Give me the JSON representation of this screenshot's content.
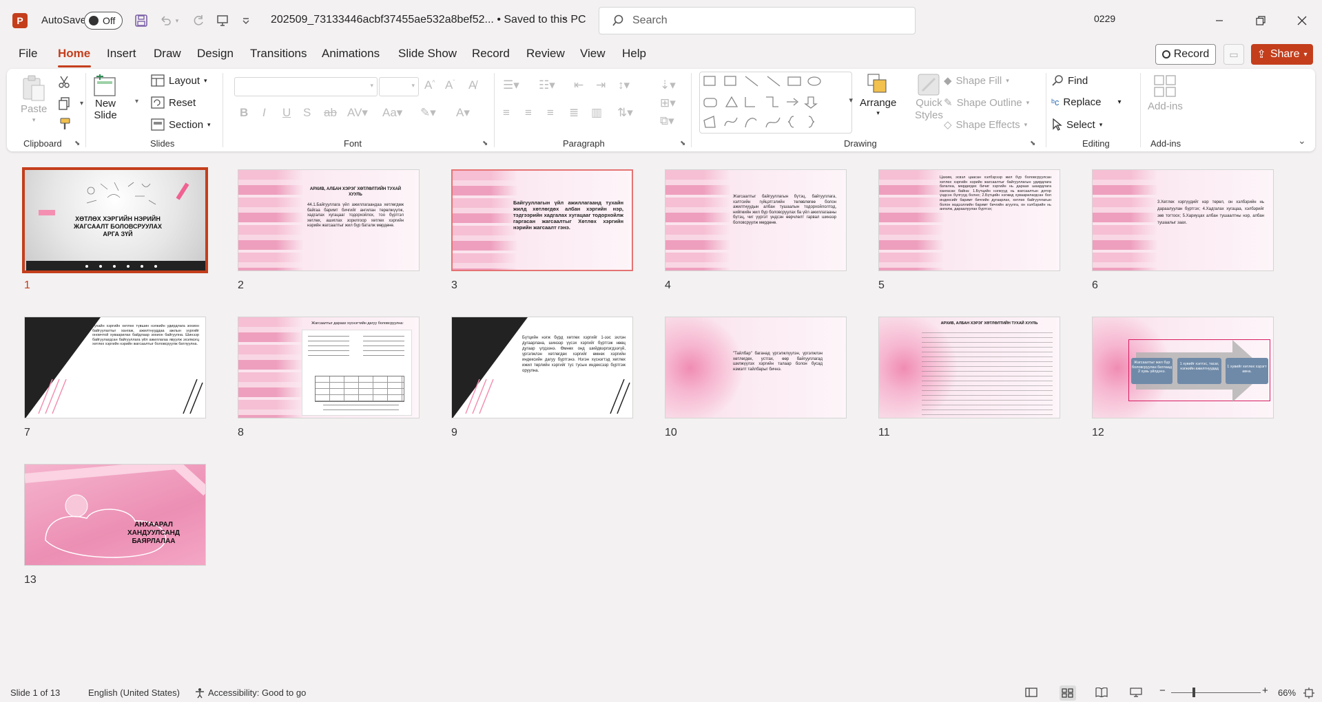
{
  "titlebar": {
    "autosave_label": "AutoSave",
    "autosave_state": "Off",
    "doc_title": "202509_73133446acbf37455ae532a8bef52... • Saved to this PC",
    "search_placeholder": "Search",
    "user": "0229"
  },
  "tabs": [
    "File",
    "Home",
    "Insert",
    "Draw",
    "Design",
    "Transitions",
    "Animations",
    "Slide Show",
    "Record",
    "Review",
    "View",
    "Help"
  ],
  "active_tab": "Home",
  "actions": {
    "record": "Record",
    "share": "Share"
  },
  "ribbon": {
    "clipboard": {
      "label": "Clipboard",
      "paste": "Paste"
    },
    "slides": {
      "label": "Slides",
      "new_slide_1": "New",
      "new_slide_2": "Slide",
      "layout": "Layout",
      "reset": "Reset",
      "section": "Section"
    },
    "font": {
      "label": "Font"
    },
    "paragraph": {
      "label": "Paragraph"
    },
    "drawing": {
      "label": "Drawing",
      "arrange": "Arrange",
      "quick_styles_1": "Quick",
      "quick_styles_2": "Styles",
      "shape_fill": "Shape Fill",
      "shape_outline": "Shape Outline",
      "shape_effects": "Shape Effects"
    },
    "editing": {
      "label": "Editing",
      "find": "Find",
      "replace": "Replace",
      "select": "Select"
    },
    "addins": {
      "label": "Add-ins",
      "button": "Add-ins"
    }
  },
  "slides": {
    "s1_title": "ХӨТЛӨХ ХЭРГИЙН НЭРИЙН ЖАГСААЛТ БОЛОВСРУУЛАХ АРГА ЗҮЙ",
    "s2_title": "АРХИВ, АЛБАН ХЭРЭГ ХӨТЛӨЛТИЙН ТУХАЙ ХУУЛЬ",
    "s2_body": "44.1.Байгууллага үйл ажиллагаандаа хөтлөгдөж байгаа баримт бичгийг ангилан төрөлжүүлж, хадгалах хугацааг тодорхойлох, тоо бүртгэл хөтлөх, ашиглах зорилгоор хөтлөх хэргийн нэрийн жагсаалтыг жил бүр баталж мөрдөнө.",
    "s3_body": "Байгууллагын үйл ажиллагаанд тухайн жилд хөтлөгдөх албан хэргийн нэр, тэдгээрийн хадгалах хугацааг тодорхойлж гаргасан жагсаалтыг Хөтлөх хэргийн нэрийн жагсаалт гэнэ.",
    "s4_body": "Жагсаалтыг байгууллагын бүтэц, байгууллага, хэлтсийн гүйцэтгэлийн төлөвлөгөө болон ажилтнуудын албан тушаалын тодорхойлолтод, нийгмийн жил бүр боловсруулах ба үйл ажиллагааны бүтэц, чиг үүргэт үндсэн өөрчлөлт гарвал шинээр боловсруулж мөрдөнө.",
    "s5_body": "Цахим, эсвэл цаасан хэлбэрээр жил бүр боловсруулсан хөтлөх хэргийн нэрийн жагсаалтыг байгууллагын удирдлага батална, мөрдөгдөх бичиг хэргийн нь дараах шаардлага хангасан байна: 1.Бүтцийн нэгжүүд нь жагсаалтын дотор үндсэн бүлгүүд болно; 2.Бүтцийн нэгжид хуваарилагдсан бол индексийг баримт бичгийн дугаарлах, хөтлөх байгууллагын болон мэдээллийн баримт бичгийн агуулга, он хэлбэрийн нь ангилж, дараалуулан бүртгэх;",
    "s6_body": "3.Хөтлөх хэргүүдийг нэр төрөл, он хэлбэрийн нь дараалуулан бүртгэх; 4.Хадгалах хугацаа, хэлбэрийг зөв тогтоох; 5.Хариуцах албан тушаалтны нэр, албан тушаалыг заах.",
    "s7_body": "Тухайн хэргийн хөтлөх түвшин нэгжийн удирдлага зохион байгуулалтыг хангаж, ажилтнууддаа ажлын үүргийг оновчтой хуваарилах байдлаар зохион байгуулна. Шинээр байгуулагдсан байгууллага үйл ажиллагаа явуулж эхэлмэгц хөтлөх хэргийн нэрийн жагсаалтыг боловсруулж батлуулна.",
    "s8_title": "Жагсаалтыг дараах хүснэгтийн дагуу боловсруулна:",
    "s9_body": "Бүтцийн нэгж бүрд хөтлөх хэргийг 1-ээс эхлэн дугаарлана, шинээр үүсэх хэргийг бүртгэж нөөц дугаар үлдээнэ. Өмнөх онд шийдвэрлэгдээгүй, үргэлжлэн хөтлөгдөх хэргийг өмнөх хэргийн индексийн дагуу бүртгэнэ. Нэгэн хүснэгтэд хөтлөх ижил төрлийн хэргийг тус тусын индексээр бүртгэж оруулна.",
    "s10_body": "\"Тайлбар\" баганад үргэлжлүүлэн, үргэлжлэн хөтлөгдөх, устгах, өөр байгууллагад шилжүүлэх хэргийн талаар болон бусад нэмэлт тайлбарыг бичнэ.",
    "s11_title": "АРХИВ, АЛБАН ХЭРЭГ ХӨТЛӨЛТИЙН ТУХАЙ ХУУЛЬ",
    "s12_box1": "Жагсаалтыг жил бүр боловсруулан батлаад 2 хувь үйлдэнэ.",
    "s12_box2": "1 хувийг хэлтэс, тасаг, нэгжийн ажилтнуудад",
    "s12_box3": "1 хувийг хөтлөх хэрэгт авна.",
    "s13_title": "АНХААРАЛ ХАНДУУЛСАНД БАЯРЛАЛАА",
    "numbers": [
      "1",
      "2",
      "3",
      "4",
      "5",
      "6",
      "7",
      "8",
      "9",
      "10",
      "11",
      "12",
      "13"
    ]
  },
  "status": {
    "slide_info": "Slide 1 of 13",
    "language": "English (United States)",
    "accessibility": "Accessibility: Good to go",
    "zoom": "66%"
  }
}
